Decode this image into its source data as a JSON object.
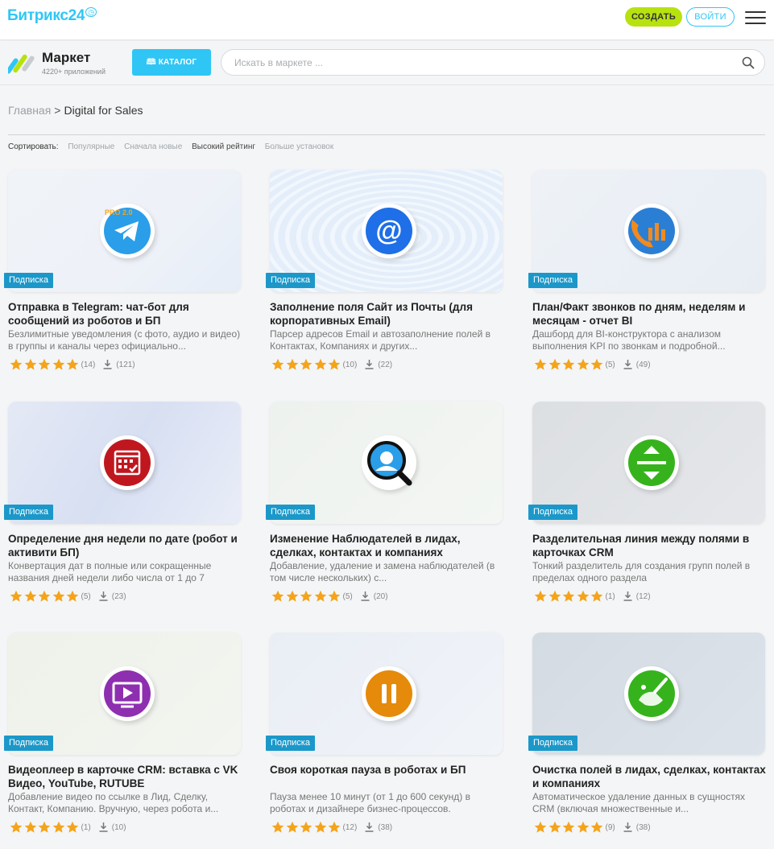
{
  "header": {
    "logo": "Битрикс24",
    "create_label": "СОЗДАТЬ",
    "login_label": "ВОЙТИ"
  },
  "market": {
    "title": "Маркет",
    "subtitle": "4220+ приложений",
    "catalog_label": "КАТАЛОГ",
    "search_placeholder": "Искать в маркете ..."
  },
  "breadcrumb": {
    "home": "Главная",
    "separator": ">",
    "current": "Digital for Sales"
  },
  "sort": {
    "label": "Сортировать:",
    "options": [
      "Популярные",
      "Сначала новые",
      "Высокий рейтинг",
      "Больше установок"
    ]
  },
  "colors": {
    "accent": "#2fc6f6",
    "create": "#b8e20f",
    "badge": "#1b98c9",
    "star": "#f4a41b"
  },
  "apps": [
    {
      "title": "Отправка в Telegram: чат-бот для сообщений из роботов и БП",
      "desc": "Безлимитные уведомления (с фото, аудио и видео) в группы и каналы через официально...",
      "badge": "Подписка",
      "rating": 5,
      "reviews": "(14)",
      "installs": "(121)",
      "icon": "telegram-icon",
      "icon_label": "PRO 2.0"
    },
    {
      "title": "Заполнение поля Сайт из Почты (для корпоративных Email)",
      "desc": "Парсер адресов Email и автозаполнение полей в Контактах, Компаниях и других...",
      "badge": "Подписка",
      "rating": 5,
      "reviews": "(10)",
      "installs": "(22)",
      "icon": "at-sign-icon"
    },
    {
      "title": "План/Факт звонков по дням, неделям и месяцам - отчет BI",
      "desc": "Дашборд для BI-конструктора с анализом выполнения KPI по звонкам и подробной...",
      "badge": "Подписка",
      "rating": 5,
      "reviews": "(5)",
      "installs": "(49)",
      "icon": "phone-chart-icon"
    },
    {
      "title": "Определение дня недели по дате (робот и активити БП)",
      "desc": "Конвертация дат в полные или сокращенные названия дней недели либо числа от 1 до 7",
      "badge": "Подписка",
      "rating": 5,
      "reviews": "(5)",
      "installs": "(23)",
      "icon": "calendar-icon"
    },
    {
      "title": "Изменение Наблюдателей в лидах, сделках, контактах и компаниях",
      "desc": "Добавление, удаление и замена наблюдателей (в том числе нескольких) с...",
      "badge": "Подписка",
      "rating": 5,
      "reviews": "(5)",
      "installs": "(20)",
      "icon": "observer-search-icon"
    },
    {
      "title": "Разделительная линия между полями в карточках CRM",
      "desc": "Тонкий разделитель для создания групп полей в пределах одного раздела",
      "badge": "Подписка",
      "rating": 5,
      "reviews": "(1)",
      "installs": "(12)",
      "icon": "divider-line-icon"
    },
    {
      "title": "Видеоплеер в карточке CRM: вставка с VK Видео, YouTube, RUTUBE",
      "desc": "Добавление видео по ссылке в Лид, Сделку, Контакт, Компанию. Вручную, через робота и...",
      "badge": "Подписка",
      "rating": 5,
      "reviews": "(1)",
      "installs": "(10)",
      "icon": "video-player-icon"
    },
    {
      "title": "Своя короткая пауза в роботах и БП",
      "desc": "Пауза менее 10 минут (от 1 до 600 секунд) в роботах и дизайнере бизнес-процессов.",
      "badge": "Подписка",
      "rating": 5,
      "reviews": "(12)",
      "installs": "(38)",
      "icon": "pause-icon"
    },
    {
      "title": "Очистка полей в лидах, сделках, контактах и компаниях",
      "desc": "Автоматическое удаление данных в сущностях CRM (включая множественные и...",
      "badge": "Подписка",
      "rating": 5,
      "reviews": "(9)",
      "installs": "(38)",
      "icon": "broom-clean-icon"
    }
  ]
}
